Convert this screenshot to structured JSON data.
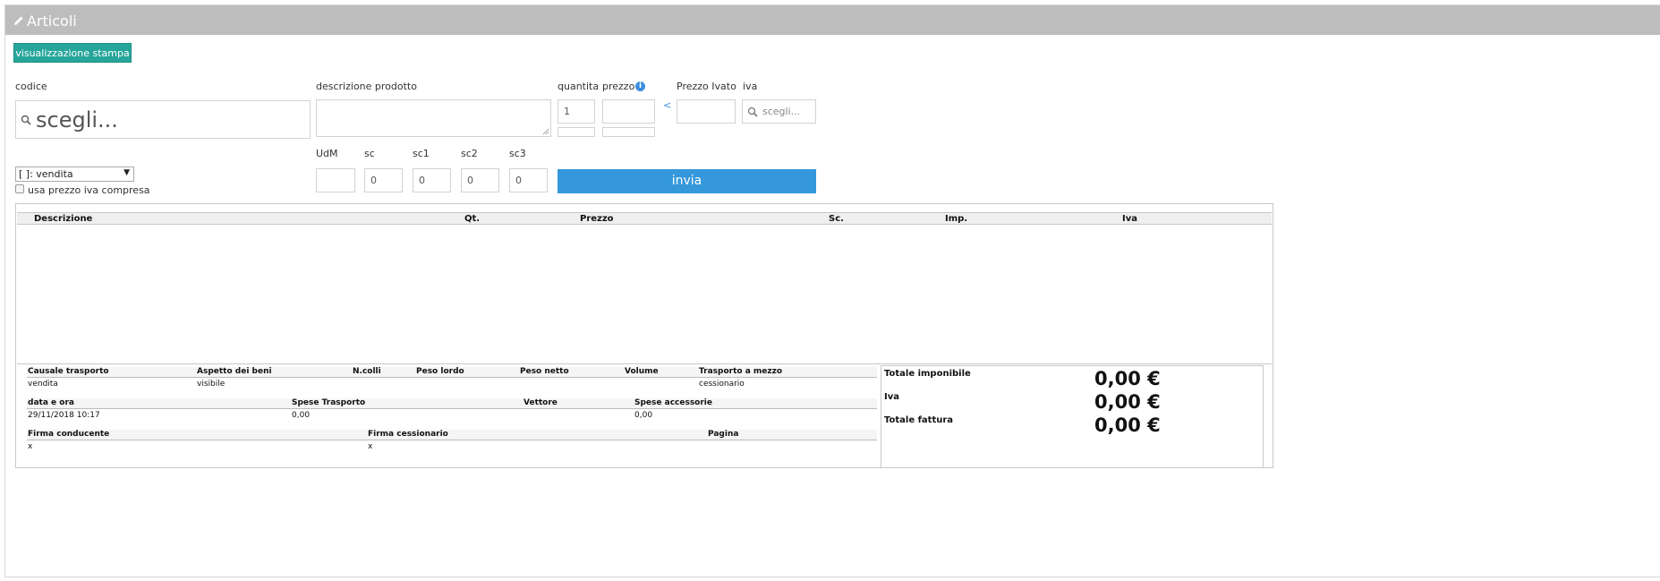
{
  "panel": {
    "title": "Articoli",
    "title_icon": "pencil-icon"
  },
  "toolbar": {
    "print_view_label": "visualizzazione stampa"
  },
  "form": {
    "codice_label": "codice",
    "codice_placeholder": "scegli...",
    "descrizione_label": "descrizione prodotto",
    "quantita_label": "quantita",
    "quantita_value": "1",
    "prezzo_label": "prezzo",
    "prezzo_ivato_label": "Prezzo Ivato",
    "arrow_symbol": "<",
    "iva_label": "iva",
    "iva_placeholder": "scegli...",
    "udm_label": "UdM",
    "sc_label": "sc",
    "sc1_label": "sc1",
    "sc2_label": "sc2",
    "sc3_label": "sc3",
    "sc_value": "0",
    "sc1_value": "0",
    "sc2_value": "0",
    "sc3_value": "0",
    "tipo_selected": "[ ]: vendita",
    "usa_prezzo_label": "usa prezzo iva compresa",
    "submit_label": "invia"
  },
  "grid": {
    "columns": [
      "Descrizione",
      "Qt.",
      "Prezzo",
      "Sc.",
      "Imp.",
      "Iva"
    ],
    "rows": []
  },
  "trasporto": {
    "headers1": [
      "Causale trasporto",
      "Aspetto dei beni",
      "N.colli",
      "Peso lordo",
      "Peso netto",
      "Volume",
      "Trasporto a mezzo"
    ],
    "causale": "vendita",
    "aspetto": "visibile",
    "mezzo": "cessionario",
    "headers2": [
      "data e ora",
      "Spese Trasporto",
      "Vettore",
      "Spese accessorie"
    ],
    "data_ora": "29/11/2018 10:17",
    "spese_trasporto": "0,00",
    "spese_accessorie": "0,00",
    "headers3": [
      "Firma conducente",
      "Firma cessionario",
      "Pagina"
    ],
    "firma_conducente": "x",
    "firma_cessionario": "x"
  },
  "totali": {
    "imponibile_label": "Totale imponibile",
    "imponibile_value": "0,00 €",
    "iva_label": "Iva",
    "iva_value": "0,00 €",
    "fattura_label": "Totale fattura",
    "fattura_value": "0,00 €"
  },
  "colors": {
    "header_bg": "#bdbdbd",
    "print_button": "#26a69a",
    "submit_button": "#3498db",
    "info_icon": "#3c8dde"
  }
}
